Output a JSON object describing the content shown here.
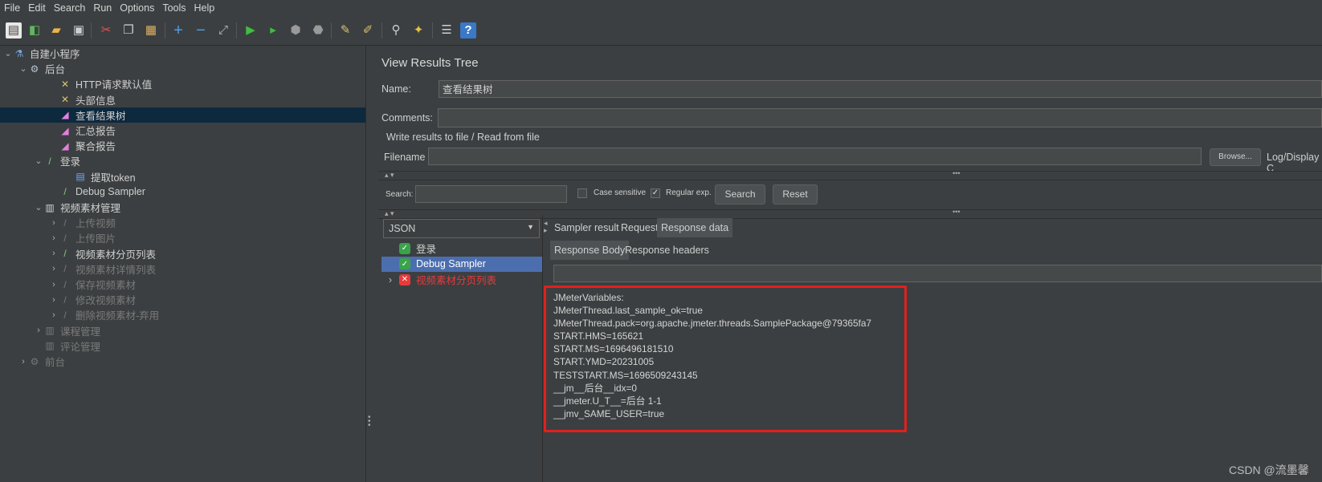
{
  "menubar": [
    "File",
    "Edit",
    "Search",
    "Run",
    "Options",
    "Tools",
    "Help"
  ],
  "tree": [
    {
      "label": "自建小程序",
      "icon": "flask-icon",
      "chevron": "⌄",
      "indent": 0,
      "disabled": false
    },
    {
      "label": "后台",
      "icon": "gear-icon",
      "chevron": "⌄",
      "indent": 1,
      "disabled": false
    },
    {
      "label": "HTTP请求默认值",
      "icon": "wrench-icon",
      "chevron": "",
      "indent": 3,
      "disabled": false
    },
    {
      "label": "头部信息",
      "icon": "wrench-icon",
      "chevron": "",
      "indent": 3,
      "disabled": false
    },
    {
      "label": "查看结果树",
      "icon": "chart-icon",
      "chevron": "",
      "indent": 3,
      "disabled": false,
      "selected": true
    },
    {
      "label": "汇总报告",
      "icon": "chart-icon",
      "chevron": "",
      "indent": 3,
      "disabled": false
    },
    {
      "label": "聚合报告",
      "icon": "chart-icon",
      "chevron": "",
      "indent": 3,
      "disabled": false
    },
    {
      "label": "登录",
      "icon": "pipette-icon",
      "chevron": "⌄",
      "indent": 2,
      "disabled": false
    },
    {
      "label": "提取token",
      "icon": "document-icon",
      "chevron": "",
      "indent": 4,
      "disabled": false
    },
    {
      "label": "Debug Sampler",
      "icon": "pipette-icon",
      "chevron": "",
      "indent": 3,
      "disabled": false
    },
    {
      "label": "视频素材管理",
      "icon": "controller-icon",
      "chevron": "⌄",
      "indent": 2,
      "disabled": false
    },
    {
      "label": "上传视频",
      "icon": "pipette-icon",
      "chevron": "›",
      "indent": 3,
      "disabled": true
    },
    {
      "label": "上传图片",
      "icon": "pipette-icon",
      "chevron": "›",
      "indent": 3,
      "disabled": true
    },
    {
      "label": "视频素材分页列表",
      "icon": "pipette-icon",
      "chevron": "›",
      "indent": 3,
      "disabled": false
    },
    {
      "label": "视频素材详情列表",
      "icon": "pipette-icon",
      "chevron": "›",
      "indent": 3,
      "disabled": true
    },
    {
      "label": "保存视频素材",
      "icon": "pipette-icon",
      "chevron": "›",
      "indent": 3,
      "disabled": true
    },
    {
      "label": "修改视频素材",
      "icon": "pipette-icon",
      "chevron": "›",
      "indent": 3,
      "disabled": true
    },
    {
      "label": "删除视频素材-弃用",
      "icon": "pipette-icon",
      "chevron": "›",
      "indent": 3,
      "disabled": true
    },
    {
      "label": "课程管理",
      "icon": "controller-icon",
      "chevron": "›",
      "indent": 2,
      "disabled": true
    },
    {
      "label": "评论管理",
      "icon": "controller-icon",
      "chevron": "",
      "indent": 2,
      "disabled": true
    },
    {
      "label": "前台",
      "icon": "gear-icon",
      "chevron": "›",
      "indent": 1,
      "disabled": true
    }
  ],
  "panel": {
    "title": "View Results Tree",
    "name_label": "Name:",
    "name_value": "查看结果树",
    "comments_label": "Comments:",
    "comments_value": "",
    "write_results_label": "Write results to file / Read from file",
    "filename_label": "Filename",
    "filename_value": "",
    "browse_label": "Browse...",
    "log_display_label": "Log/Display C"
  },
  "search": {
    "label": "Search:",
    "value": "",
    "case_sensitive_label": "Case sensitive",
    "case_sensitive_checked": false,
    "regular_exp_label": "Regular exp.",
    "regular_exp_checked": true,
    "search_button": "Search",
    "reset_button": "Reset"
  },
  "renderer": {
    "selected": "JSON"
  },
  "results": [
    {
      "label": "登录",
      "status": "success",
      "selected": false,
      "expandable": false
    },
    {
      "label": "Debug Sampler",
      "status": "success",
      "selected": true,
      "expandable": false
    },
    {
      "label": "视频素材分页列表",
      "status": "error",
      "selected": false,
      "expandable": true
    }
  ],
  "tabs": [
    "Sampler result",
    "Request",
    "Response data"
  ],
  "active_tab": "Response data",
  "subtabs": [
    "Response Body",
    "Response headers"
  ],
  "active_subtab": "Response Body",
  "response_lines": [
    "JMeterVariables:",
    "JMeterThread.last_sample_ok=true",
    "JMeterThread.pack=org.apache.jmeter.threads.SamplePackage@79365fa7",
    "START.HMS=165621",
    "START.MS=1696496181510",
    "START.YMD=20231005",
    "TESTSTART.MS=1696509243145",
    "__jm__后台__idx=0",
    "__jmeter.U_T__=后台 1-1",
    "__jmv_SAME_USER=true"
  ],
  "watermark": "CSDN @流墨馨",
  "colors": {
    "selection": "#4b6eaf",
    "tree_selection": "#0d293e",
    "highlight_box": "#e0211d",
    "error": "#e83a3a",
    "success": "#3aa34a"
  }
}
